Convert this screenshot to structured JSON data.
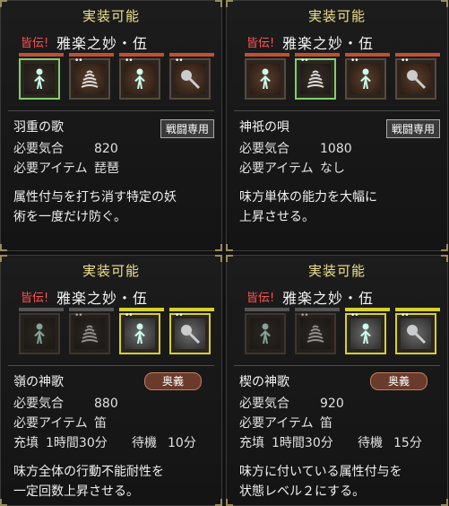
{
  "panels": [
    {
      "header": "実装可能",
      "tier_label": "皆伝!",
      "set_name": "雅楽之妙・伍",
      "slot_states": [
        "active",
        "learned",
        "learned",
        "learned"
      ],
      "slot_icons": [
        "figure-icon",
        "wave-icon",
        "figure-icon",
        "axe-icon"
      ],
      "skill_name": "羽重の歌",
      "badge": "戦闘専用",
      "badge_type": "plain",
      "stats": [
        {
          "label": "必要気合",
          "value": "820"
        },
        {
          "label": "必要アイテム",
          "value": "琵琶"
        }
      ],
      "description": [
        "属性付与を打ち消す特定の妖",
        "術を一度だけ防ぐ。"
      ]
    },
    {
      "header": "実装可能",
      "tier_label": "皆伝!",
      "set_name": "雅楽之妙・伍",
      "slot_states": [
        "learned",
        "active",
        "learned",
        "learned"
      ],
      "slot_icons": [
        "figure-icon",
        "wave-icon",
        "figure-icon",
        "axe-icon"
      ],
      "skill_name": "神祇の唄",
      "badge": "戦闘専用",
      "badge_type": "plain",
      "stats": [
        {
          "label": "必要気合",
          "value": "1080"
        },
        {
          "label": "必要アイテム",
          "value": "なし"
        }
      ],
      "description": [
        "味方単体の能力を大幅に",
        "上昇させる。"
      ]
    },
    {
      "header": "実装可能",
      "tier_label": "皆伝!",
      "set_name": "雅楽之妙・伍",
      "slot_states": [
        "dim",
        "dim",
        "avail",
        "avail"
      ],
      "slot_icons": [
        "figure-icon",
        "wave-icon",
        "figure-icon",
        "axe-icon"
      ],
      "skill_name": "嶺の神歌",
      "badge": "奥義",
      "badge_type": "ougi",
      "stats": [
        {
          "label": "必要気合",
          "value": "880"
        },
        {
          "label": "必要アイテム",
          "value": "笛"
        }
      ],
      "charge": {
        "label": "充填",
        "value": "1時間30分",
        "wait_label": "待機",
        "wait_value": "10分"
      },
      "description": [
        "味方全体の行動不能耐性を",
        "一定回数上昇させる。"
      ]
    },
    {
      "header": "実装可能",
      "tier_label": "皆伝!",
      "set_name": "雅楽之妙・伍",
      "slot_states": [
        "dim",
        "dim",
        "avail",
        "avail"
      ],
      "slot_icons": [
        "figure-icon",
        "wave-icon",
        "figure-icon",
        "axe-icon"
      ],
      "skill_name": "楔の神歌",
      "badge": "奥義",
      "badge_type": "ougi",
      "stats": [
        {
          "label": "必要気合",
          "value": "920"
        },
        {
          "label": "必要アイテム",
          "value": "笛"
        }
      ],
      "charge": {
        "label": "充填",
        "value": "1時間30分",
        "wait_label": "待機",
        "wait_value": "15分"
      },
      "description": [
        "味方に付いている属性付与を",
        "状態レベル２にする。"
      ]
    }
  ],
  "colors": {
    "header": "#f0e08a",
    "tier": "#ff5050",
    "slot_learned": "#c05030",
    "slot_available": "#d6d02a",
    "slot_active": "#7fd06a"
  }
}
